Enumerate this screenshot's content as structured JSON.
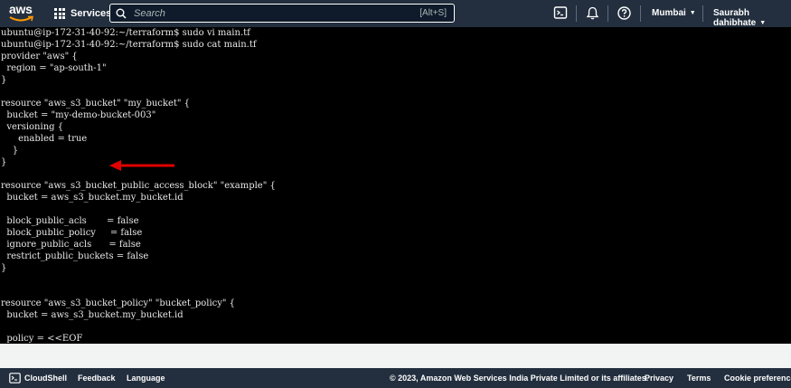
{
  "header": {
    "logo_text": "aws",
    "services_label": "Services",
    "search": {
      "placeholder": "Search",
      "shortcut": "[Alt+S]"
    },
    "region": "Mumbai",
    "user": "Saurabh dahibhate",
    "icons": [
      "cloudshell-icon",
      "bell-icon",
      "help-icon"
    ]
  },
  "terminal": {
    "lines": [
      "ubuntu@ip-172-31-40-92:~/terraform$ sudo vi main.tf",
      "ubuntu@ip-172-31-40-92:~/terraform$ sudo cat main.tf",
      "provider \"aws\" {",
      "  region = \"ap-south-1\"",
      "}",
      "",
      "resource \"aws_s3_bucket\" \"my_bucket\" {",
      "  bucket = \"my-demo-bucket-003\"",
      "  versioning {",
      "      enabled = true",
      "    }",
      "}",
      "",
      "resource \"aws_s3_bucket_public_access_block\" \"example\" {",
      "  bucket = aws_s3_bucket.my_bucket.id",
      "",
      "  block_public_acls       = false",
      "  block_public_policy     = false",
      "  ignore_public_acls      = false",
      "  restrict_public_buckets = false",
      "}",
      "",
      "",
      "resource \"aws_s3_bucket_policy\" \"bucket_policy\" {",
      "  bucket = aws_s3_bucket.my_bucket.id",
      "",
      "  policy = <<EOF"
    ],
    "annotation_color": "#e00000"
  },
  "footer": {
    "cloudshell": "CloudShell",
    "feedback": "Feedback",
    "language": "Language",
    "copyright": "© 2023, Amazon Web Services India Private Limited or its affiliates.",
    "privacy": "Privacy",
    "terms": "Terms",
    "cookies": "Cookie preferences"
  },
  "colors": {
    "nav_bg": "#232f3e",
    "aws_orange": "#ff9900",
    "terminal_bg": "#000000"
  }
}
